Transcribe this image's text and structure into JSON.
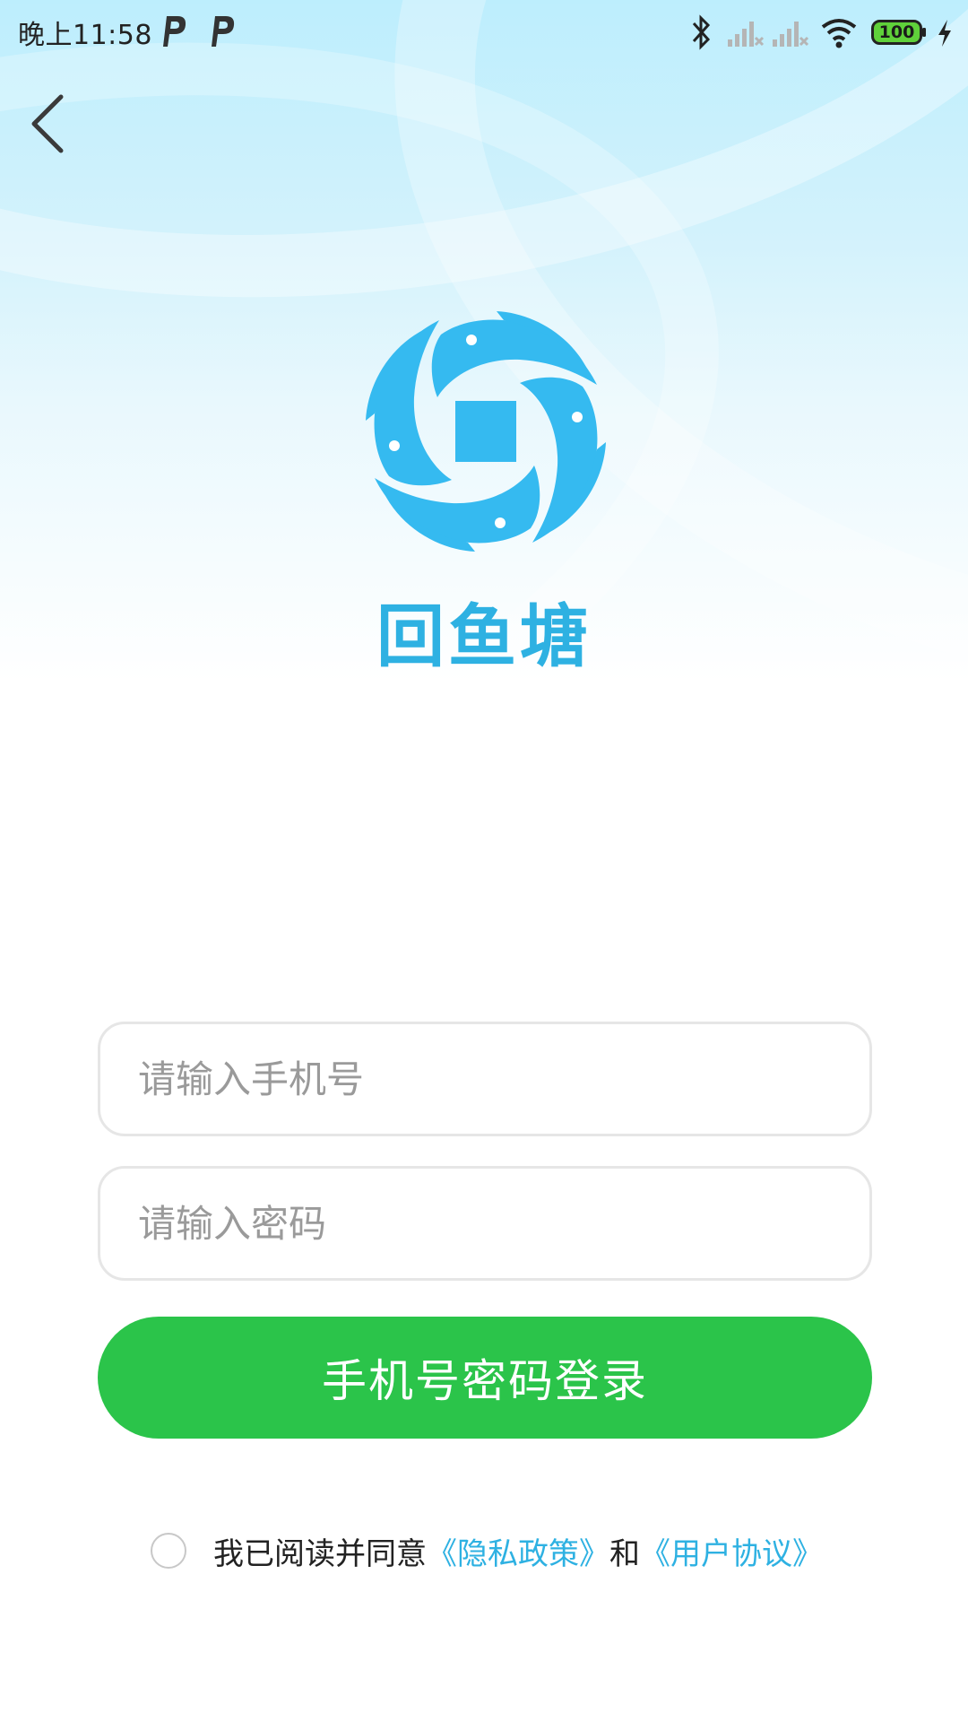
{
  "status_bar": {
    "time": "晚上11:58",
    "notification_icons": [
      "p-icon",
      "p-icon"
    ],
    "right_icons": [
      "bluetooth-icon",
      "signal-icon",
      "signal-icon",
      "wifi-icon",
      "battery-icon",
      "charging-icon"
    ],
    "battery_level": "100"
  },
  "nav": {
    "back_icon": "chevron-left-icon"
  },
  "brand": {
    "logo_icon": "fish-pond-logo-icon",
    "app_name": "回鱼塘"
  },
  "form": {
    "phone_placeholder": "请输入手机号",
    "password_placeholder": "请输入密码",
    "login_label": "手机号密码登录"
  },
  "agreement": {
    "prefix": "我已阅读并同意",
    "privacy_link": "《隐私政策》",
    "conjunction": "和",
    "terms_link": "《用户协议》"
  },
  "colors": {
    "accent_blue": "#2eb1e2",
    "logo_blue": "#35baf0",
    "button_green": "#2bc44a"
  }
}
